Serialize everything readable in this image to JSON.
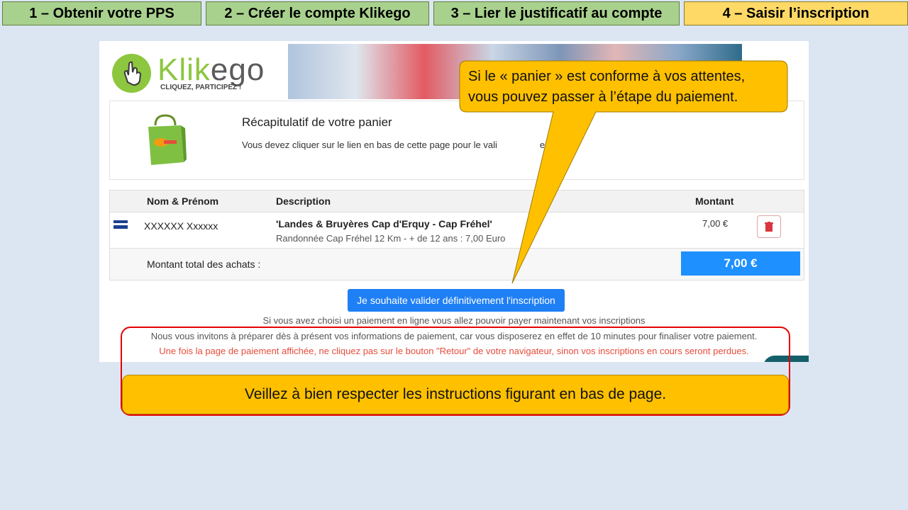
{
  "steps": [
    {
      "label": "1 – Obtenir votre PPS"
    },
    {
      "label": "2 – Créer le compte Klikego"
    },
    {
      "label": "3 – Lier le justificatif au compte"
    },
    {
      "label": "4 – Saisir l’inscription"
    }
  ],
  "brand": {
    "word_main": "Klik",
    "word_go": "ego",
    "tagline": "CLIQUEZ, PARTICIPEZ !"
  },
  "summary": {
    "title": "Récapitulatif de votre panier",
    "subtitle": "Vous devez cliquer sur le lien en bas de cette page pour le vali",
    "subtitle_end": "ent"
  },
  "table": {
    "headers": {
      "name": "Nom & Prénom",
      "description": "Description",
      "amount": "Montant"
    },
    "row": {
      "name": "XXXXXX Xxxxxx",
      "desc_title": "'Landes & Bruyères Cap d'Erquy - Cap Fréhel'",
      "desc_detail": "Randonnée Cap Fréhel 12 Km - + de 12 ans : 7,00 Euro",
      "amount": "7,00 €"
    },
    "total_label": "Montant total des achats :",
    "total_value": "7,00 €"
  },
  "validate_button": "Je souhaite valider définitivement l'inscription",
  "notes": {
    "line1": "Si vous avez choisi un paiement en ligne vous allez pouvoir payer maintenant vos inscriptions",
    "line2": "Nous vous invitons à préparer dès à présent vos informations de paiement, car vous disposerez en effet de 10 minutes pour finaliser votre paiement.",
    "line3": "Une fois la page de paiement affichée, ne cliquez pas sur le bouton \"Retour\" de votre navigateur, sinon vos inscriptions en cours seront perdues."
  },
  "callouts": {
    "top_line1": "Si le « panier » est conforme à vos attentes,",
    "top_line2": "vous pouvez passer à l’étape du paiement.",
    "bottom": "Veillez à bien respecter les instructions figurant en bas de page."
  },
  "colors": {
    "step_done": "#a9d18e",
    "step_active": "#ffd966",
    "callout": "#ffc000",
    "frame": "#e60000",
    "brand": "#8dc63f",
    "primary": "#1f7ff5"
  }
}
